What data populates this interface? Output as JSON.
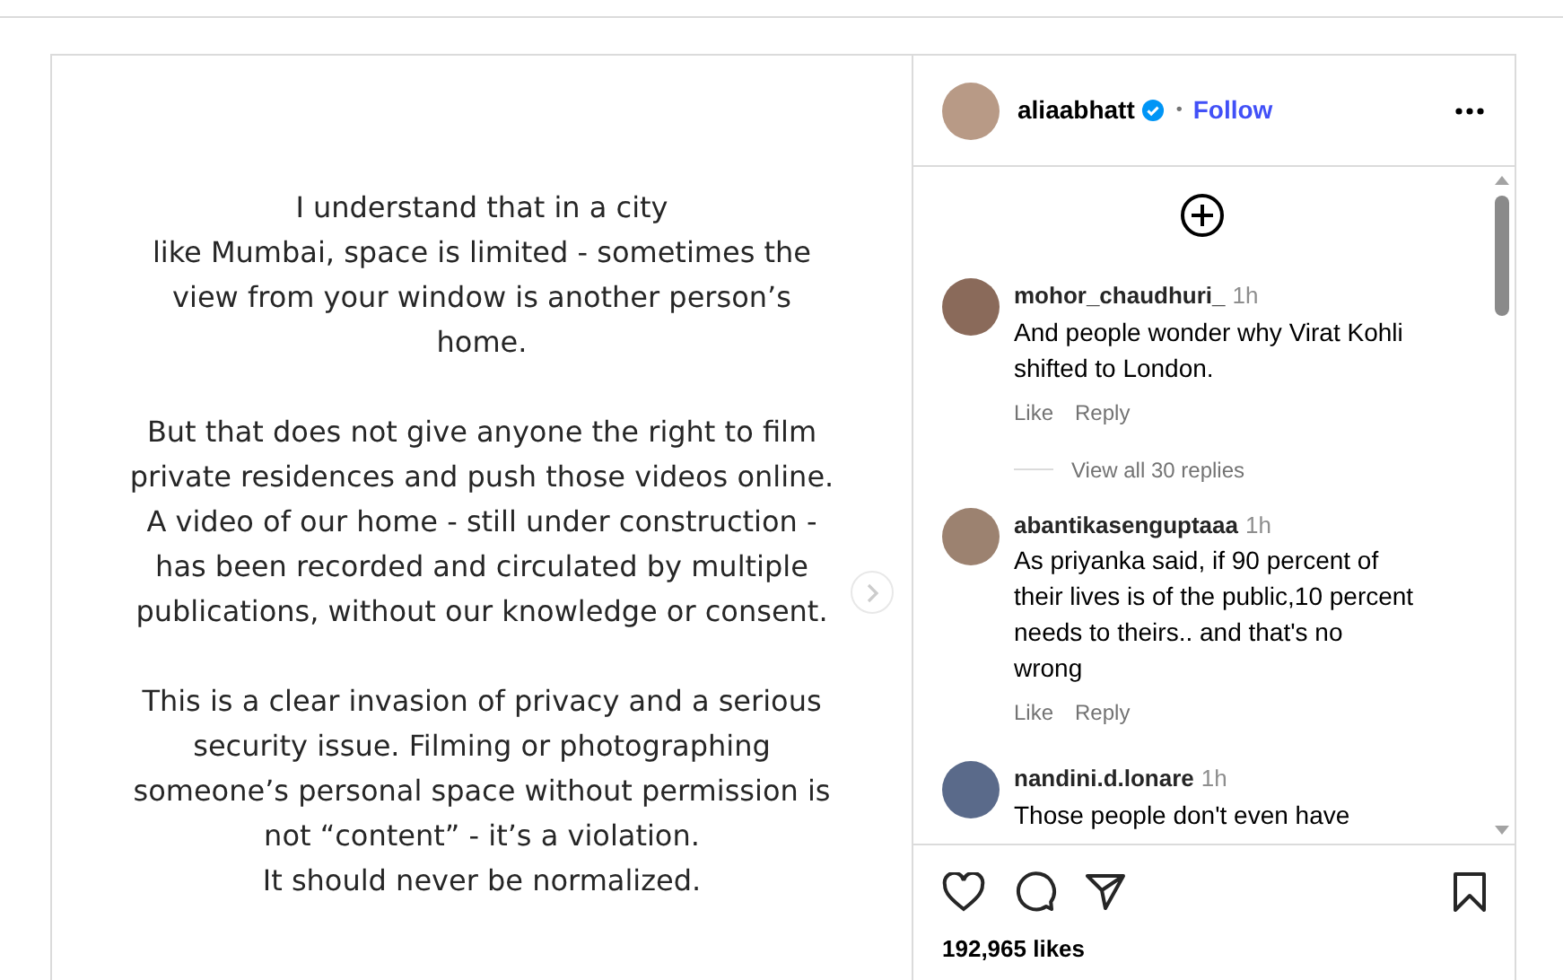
{
  "post_text": [
    [
      "I understand that in a city",
      "like Mumbai, space is limited - sometimes the",
      "view from your window is another person’s",
      "home."
    ],
    [
      "But that does not give anyone the right to film",
      "private residences and push those videos online.",
      "A video of our home - still under construction -",
      "has been recorded and circulated by multiple",
      "publications, without our knowledge or consent."
    ],
    [
      "This is a clear invasion of privacy and a serious",
      "security issue. Filming or photographing",
      "someone’s personal space without permission is",
      "not “content” - it’s a violation.",
      "It should never be normalized."
    ]
  ],
  "header": {
    "username": "aliaabhatt",
    "verified": true,
    "separator": "•",
    "follow": "Follow"
  },
  "comments": [
    {
      "username": "mohor_chaudhuri_",
      "time": "1h",
      "text": "And people wonder why Virat Kohli shifted to London.",
      "like": "Like",
      "reply": "Reply",
      "view_replies": "View all 30 replies"
    },
    {
      "username": "abantikasenguptaaa",
      "time": "1h",
      "text": "As priyanka said, if 90 percent of their lives is of the public,10 percent needs to theirs.. and that's no wrong",
      "like": "Like",
      "reply": "Reply"
    },
    {
      "username": "nandini.d.lonare",
      "time": "1h",
      "text": "Those people don't even have"
    }
  ],
  "likes": "192,965 likes"
}
